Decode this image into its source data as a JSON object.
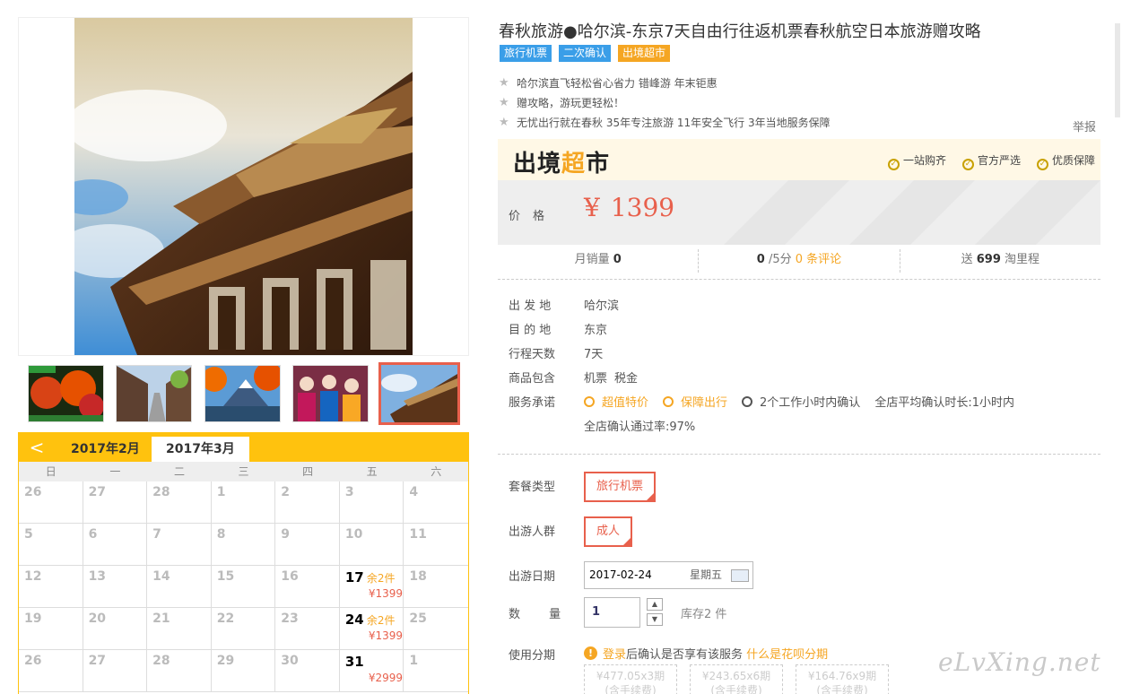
{
  "product": {
    "title": "春秋旅游●哈尔滨-东京7天自由行往返机票春秋航空日本旅游赠攻略",
    "tags": [
      "旅行机票",
      "二次确认",
      "出境超市"
    ],
    "features": [
      "哈尔滨直飞轻松省心省力 错峰游 年末钜惠",
      "赠攻略，游玩更轻松！",
      "无忧出行就在春秋 35年专注旅游 11年安全飞行 3年当地服务保障"
    ],
    "report_label": "举报"
  },
  "brand": {
    "logo_a": "出境",
    "logo_b": "超",
    "logo_c": "市",
    "badges": [
      "一站购齐",
      "官方严选",
      "优质保障"
    ]
  },
  "price": {
    "label": "价格",
    "currency": "¥",
    "value": "1399"
  },
  "stats": {
    "monthly_sales_label": "月销量",
    "monthly_sales": "0",
    "score": "0",
    "score_suffix": "/5分",
    "reviews": "0 条评论",
    "points_prefix": "送",
    "points": "699",
    "points_suffix": "淘里程"
  },
  "info": {
    "rows": [
      {
        "k": "出 发 地",
        "v": "哈尔滨"
      },
      {
        "k": "目 的 地",
        "v": "东京"
      },
      {
        "k": "行程天数",
        "v": "7天"
      }
    ],
    "includes_label": "商品包含",
    "includes": [
      "机票",
      "税金"
    ],
    "promise_label": "服务承诺",
    "promises": [
      "超值特价",
      "保障出行",
      "2个工作小时内确认"
    ],
    "promise_extra_1": "全店平均确认时长:1小时内",
    "promise_extra_2": "全店确认通过率:97%"
  },
  "options": {
    "package_label": "套餐类型",
    "package_value": "旅行机票",
    "people_label": "出游人群",
    "people_value": "成人",
    "date_label": "出游日期",
    "date_value": "2017-02-24",
    "date_weekday": "星期五",
    "qty_label": "数 量",
    "qty_value": "1",
    "stock": "库存2 件",
    "installment_label": "使用分期",
    "installment_login": "登录",
    "installment_text": "后确认是否享有该服务",
    "installment_link": "什么是花呗分期",
    "installments": [
      {
        "amount": "¥477.05x3期",
        "note": "(含手续费)"
      },
      {
        "amount": "¥243.65x6期",
        "note": "(含手续费)"
      },
      {
        "amount": "¥164.76x9期",
        "note": "(含手续费)"
      }
    ]
  },
  "calendar": {
    "prev_label": "<",
    "tabs": [
      "2017年2月",
      "2017年3月"
    ],
    "weekdays": [
      "日",
      "一",
      "二",
      "三",
      "四",
      "五",
      "六"
    ],
    "rows": [
      [
        {
          "d": "26"
        },
        {
          "d": "27"
        },
        {
          "d": "28"
        },
        {
          "d": "1"
        },
        {
          "d": "2"
        },
        {
          "d": "3"
        },
        {
          "d": "4"
        }
      ],
      [
        {
          "d": "5"
        },
        {
          "d": "6"
        },
        {
          "d": "7"
        },
        {
          "d": "8"
        },
        {
          "d": "9"
        },
        {
          "d": "10"
        },
        {
          "d": "11"
        }
      ],
      [
        {
          "d": "12"
        },
        {
          "d": "13"
        },
        {
          "d": "14"
        },
        {
          "d": "15"
        },
        {
          "d": "16"
        },
        {
          "d": "17",
          "left": "余2件",
          "price": "¥1399"
        },
        {
          "d": "18"
        }
      ],
      [
        {
          "d": "19"
        },
        {
          "d": "20"
        },
        {
          "d": "21"
        },
        {
          "d": "22"
        },
        {
          "d": "23"
        },
        {
          "d": "24",
          "left": "余2件",
          "price": "¥1399"
        },
        {
          "d": "25"
        }
      ],
      [
        {
          "d": "26"
        },
        {
          "d": "27"
        },
        {
          "d": "28"
        },
        {
          "d": "29"
        },
        {
          "d": "30"
        },
        {
          "d": "31",
          "price": "¥2999"
        },
        {
          "d": "1"
        }
      ]
    ]
  },
  "watermark": "eLvXing.net",
  "thumbs": [
    "autumn-leaves-thumb",
    "old-street-thumb",
    "mount-fuji-thumb",
    "dolls-thumb",
    "temple-thumb"
  ]
}
